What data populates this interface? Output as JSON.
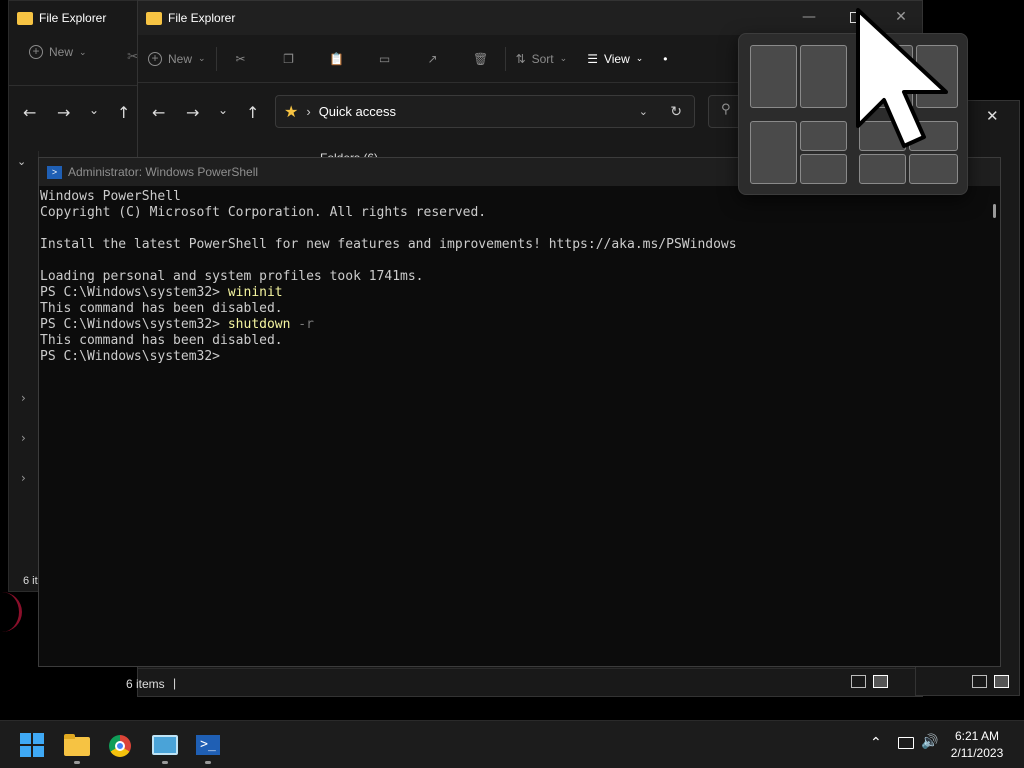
{
  "explorer_back": {
    "title": "File Explorer",
    "toolbar": {
      "new_label": "New"
    },
    "status": "6 it"
  },
  "explorer_front": {
    "title": "File Explorer",
    "toolbar": {
      "new_label": "New",
      "sort_label": "Sort",
      "view_label": "View",
      "more_label": "•"
    },
    "address": {
      "location": "Quick access"
    },
    "folders_heading": "Folders (6)",
    "status": {
      "items": "6 items",
      "divider": "|"
    }
  },
  "powershell": {
    "title": "Administrator: Windows PowerShell",
    "lines": {
      "l1": "Windows PowerShell",
      "l2": "Copyright (C) Microsoft Corporation. All rights reserved.",
      "l4": "Install the latest PowerShell for new features and improvements! https://aka.ms/PSWindows",
      "l6": "Loading personal and system profiles took 1741ms.",
      "prompt": "PS C:\\Windows\\system32> ",
      "cmd1": "wininit",
      "disabled": "This command has been disabled.",
      "cmd2": "shutdown",
      "cmd2_arg": " -r"
    }
  },
  "taskbar": {
    "time": "6:21 AM",
    "date": "2/11/2023"
  },
  "colors": {
    "folder_yellow": "#f6c343",
    "ps_blue": "#1f5fb4",
    "console_text": "#cccccc"
  },
  "icons": [
    "folder-icon",
    "windows-start-icon",
    "chrome-icon",
    "powershell-icon",
    "control-panel-icon",
    "chevron-up-icon",
    "network-icon",
    "volume-icon",
    "star-icon",
    "refresh-icon",
    "search-icon",
    "sort-icon",
    "view-icon"
  ]
}
